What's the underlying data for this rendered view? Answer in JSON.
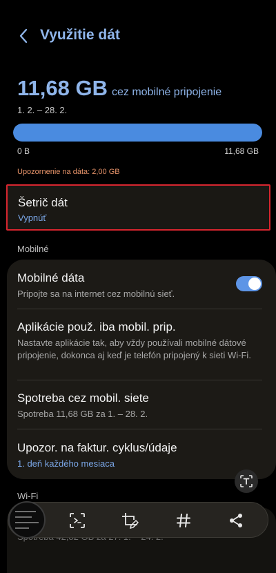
{
  "header": {
    "title": "Využitie dát",
    "back_icon": "chevron-left-icon"
  },
  "usage": {
    "value": "11,68 GB",
    "suffix": "cez mobilné pripojenie",
    "period": "1. 2. – 28. 2.",
    "bar_fill_fraction": 1.0,
    "bar_min_label": "0 B",
    "bar_max_label": "11,68 GB",
    "warning": "Upozornenie na dáta: 2,00 GB"
  },
  "data_saver": {
    "title": "Šetrič dát",
    "status": "Vypnúť"
  },
  "sections": {
    "mobile": "Mobilné",
    "wifi": "Wi-Fi"
  },
  "mobile_items": [
    {
      "title": "Mobilné dáta",
      "subtitle": "Pripojte sa na internet cez mobilnú sieť.",
      "toggle_on": true
    },
    {
      "title": "Aplikácie použ. iba mobil. prip.",
      "subtitle": "Nastavte aplikácie tak, aby vždy používali mobilné dátové pripojenie, dokonca aj keď je telefón pripojený k sieti Wi-Fi."
    },
    {
      "title": "Spotreba cez mobil. siete",
      "subtitle": "Spotreba 11,68 GB za 1. – 28. 2."
    },
    {
      "title": "Upozor. na faktur. cyklus/údaje",
      "subtitle": "1. deň každého mesiaca"
    }
  ],
  "wifi_peek": "Spotreba 42,82 GB za 27. 1. – 24. 2.",
  "toolbar": {
    "icons": [
      "screenshot-thumbnail",
      "scan-text-icon",
      "crop-edit-icon",
      "hashtag-icon",
      "share-icon"
    ]
  },
  "colors": {
    "accent": "#8fb5ea",
    "link": "#7aa6e6",
    "warning": "#e8946a",
    "highlight_border": "#d8262f",
    "toggle": "#5e95e6"
  }
}
